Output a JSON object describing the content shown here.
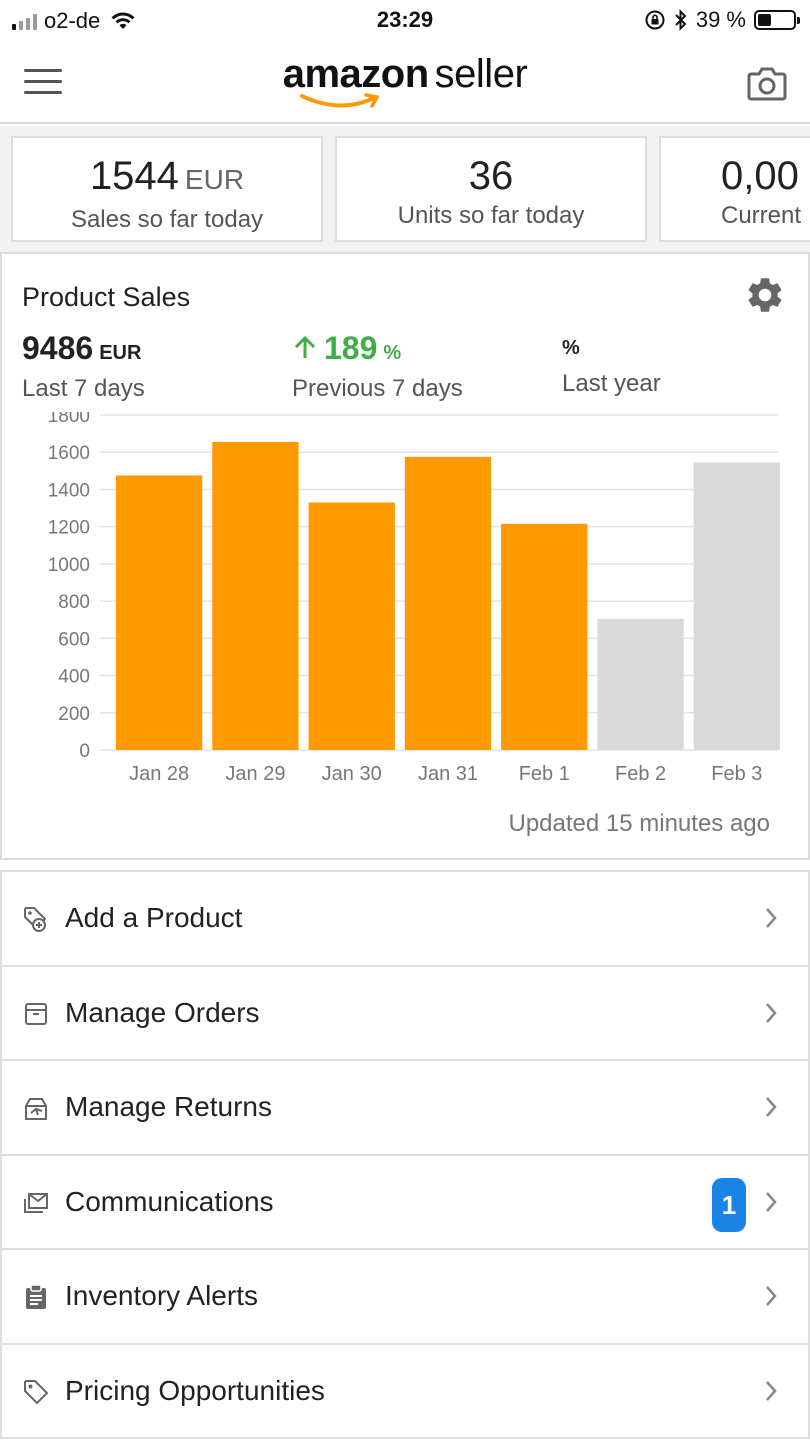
{
  "status_bar": {
    "carrier": "o2-de",
    "time": "23:29",
    "battery_percent": "39 %",
    "battery_level": 0.39
  },
  "header": {
    "logo_bold": "amazon",
    "logo_light": "seller"
  },
  "stats": [
    {
      "value": "1544",
      "unit": "EUR",
      "label": "Sales so far today"
    },
    {
      "value": "36",
      "unit": "",
      "label": "Units so far today"
    },
    {
      "value": "0,00",
      "unit": "",
      "label": "Current"
    }
  ],
  "sales_panel": {
    "title": "Product Sales",
    "metrics": [
      {
        "value": "9486",
        "unit": "EUR",
        "label": "Last 7 days"
      },
      {
        "value": "189",
        "unit": "%",
        "label": "Previous 7 days",
        "trend": "up"
      },
      {
        "value": "",
        "unit": "%",
        "label": "Last year"
      }
    ],
    "updated": "Updated 15 minutes ago"
  },
  "chart_data": {
    "type": "bar",
    "categories": [
      "Jan 28",
      "Jan 29",
      "Jan 30",
      "Jan 31",
      "Feb 1",
      "Feb 2",
      "Feb 3"
    ],
    "values": [
      1475,
      1655,
      1330,
      1575,
      1215,
      705,
      1545
    ],
    "bar_colors": [
      "#ff9900",
      "#ff9900",
      "#ff9900",
      "#ff9900",
      "#ff9900",
      "#d9d9d9",
      "#d9d9d9"
    ],
    "yticks": [
      0,
      200,
      400,
      600,
      800,
      1000,
      1200,
      1400,
      1600,
      1800
    ],
    "ylim": [
      0,
      1800
    ],
    "grid": true,
    "title": "",
    "xlabel": "",
    "ylabel": ""
  },
  "menu": [
    {
      "label": "Add a Product",
      "icon": "tag-plus-icon"
    },
    {
      "label": "Manage Orders",
      "icon": "box-icon"
    },
    {
      "label": "Manage Returns",
      "icon": "return-box-icon"
    },
    {
      "label": "Communications",
      "icon": "mail-icon",
      "badge": "1"
    },
    {
      "label": "Inventory Alerts",
      "icon": "clipboard-icon"
    },
    {
      "label": "Pricing Opportunities",
      "icon": "tag-icon"
    }
  ],
  "colors": {
    "amazon_orange": "#ff9900",
    "positive_green": "#3fae49",
    "badge_blue": "#1a84e5",
    "bar_gray": "#d9d9d9"
  }
}
